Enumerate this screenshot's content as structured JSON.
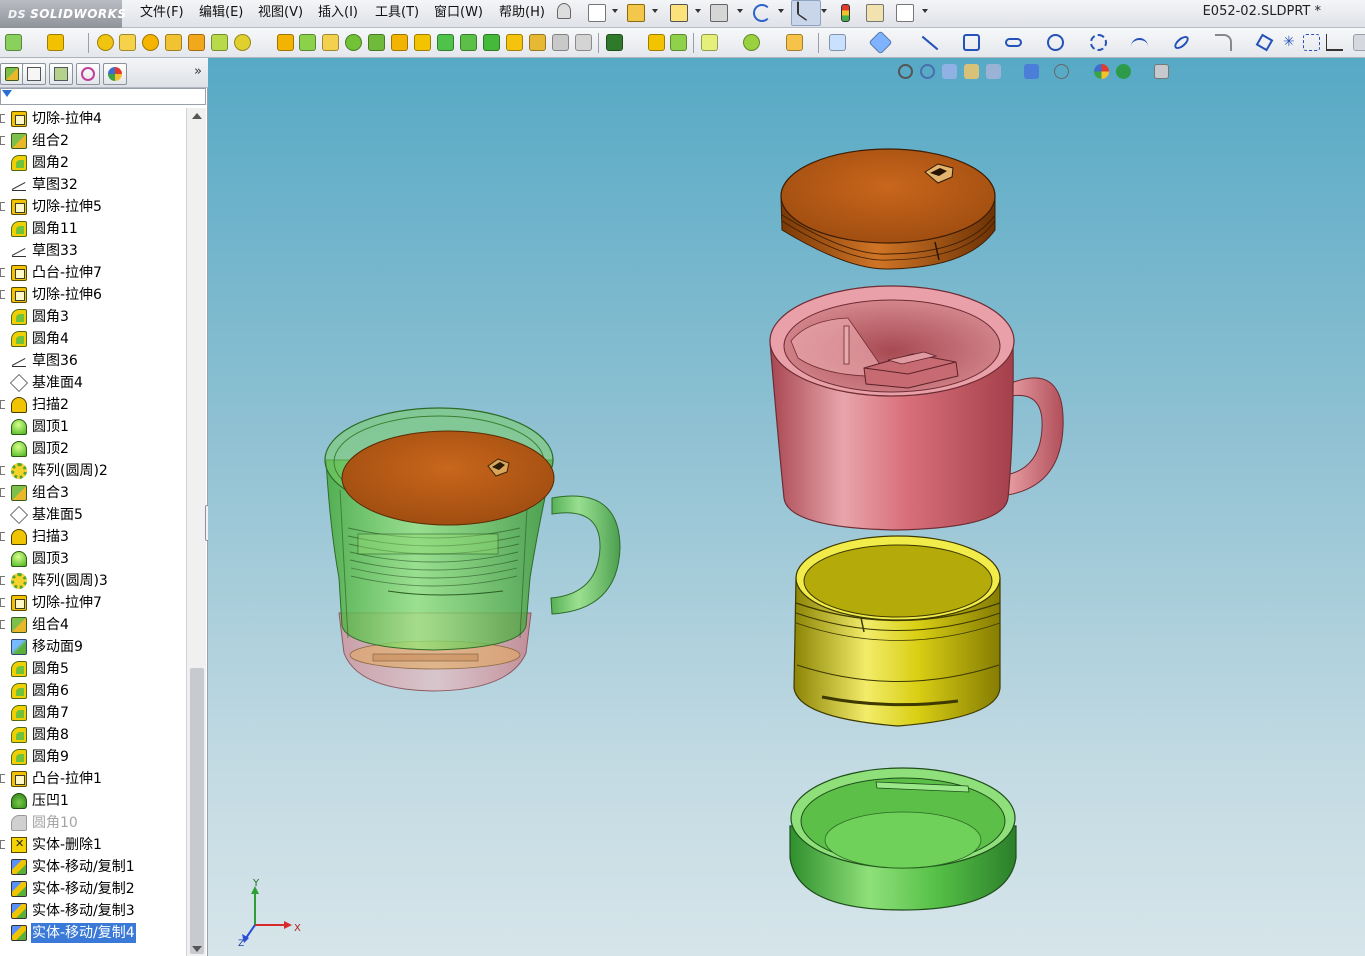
{
  "app": {
    "brand": "SOLIDWORKS",
    "brand_prefix": "DS",
    "document_title": "E052-02.SLDPRT *"
  },
  "menu": {
    "items": [
      "文件(F)",
      "编辑(E)",
      "视图(V)",
      "插入(I)",
      "工具(T)",
      "窗口(W)",
      "帮助(H)"
    ]
  },
  "feature_tree": {
    "items": [
      {
        "label": "切除-拉伸4",
        "icon": "extrude-cut-icon",
        "expandable": true
      },
      {
        "label": "组合2",
        "icon": "combine-icon",
        "expandable": true
      },
      {
        "label": "圆角2",
        "icon": "fillet-icon",
        "expandable": false
      },
      {
        "label": "草图32",
        "icon": "sketch-icon",
        "expandable": false
      },
      {
        "label": "切除-拉伸5",
        "icon": "extrude-cut-icon",
        "expandable": true
      },
      {
        "label": "圆角11",
        "icon": "fillet-icon",
        "expandable": false
      },
      {
        "label": "草图33",
        "icon": "sketch-icon",
        "expandable": false
      },
      {
        "label": "凸台-拉伸7",
        "icon": "boss-extrude-icon",
        "expandable": true
      },
      {
        "label": "切除-拉伸6",
        "icon": "extrude-cut-icon",
        "expandable": true
      },
      {
        "label": "圆角3",
        "icon": "fillet-icon",
        "expandable": false
      },
      {
        "label": "圆角4",
        "icon": "fillet-icon",
        "expandable": false
      },
      {
        "label": "草图36",
        "icon": "sketch-icon",
        "expandable": false
      },
      {
        "label": "基准面4",
        "icon": "plane-icon",
        "expandable": false
      },
      {
        "label": "扫描2",
        "icon": "sweep-icon",
        "expandable": true
      },
      {
        "label": "圆顶1",
        "icon": "dome-icon",
        "expandable": false
      },
      {
        "label": "圆顶2",
        "icon": "dome-icon",
        "expandable": false
      },
      {
        "label": "阵列(圆周)2",
        "icon": "circular-pattern-icon",
        "expandable": true
      },
      {
        "label": "组合3",
        "icon": "combine-icon",
        "expandable": true
      },
      {
        "label": "基准面5",
        "icon": "plane-icon",
        "expandable": false
      },
      {
        "label": "扫描3",
        "icon": "sweep-icon",
        "expandable": true
      },
      {
        "label": "圆顶3",
        "icon": "dome-icon",
        "expandable": false
      },
      {
        "label": "阵列(圆周)3",
        "icon": "circular-pattern-icon",
        "expandable": true
      },
      {
        "label": "切除-拉伸7",
        "icon": "extrude-cut-icon",
        "expandable": true
      },
      {
        "label": "组合4",
        "icon": "combine-icon",
        "expandable": true
      },
      {
        "label": "移动面9",
        "icon": "move-face-icon",
        "expandable": false
      },
      {
        "label": "圆角5",
        "icon": "fillet-icon",
        "expandable": false
      },
      {
        "label": "圆角6",
        "icon": "fillet-icon",
        "expandable": false
      },
      {
        "label": "圆角7",
        "icon": "fillet-icon",
        "expandable": false
      },
      {
        "label": "圆角8",
        "icon": "fillet-icon",
        "expandable": false
      },
      {
        "label": "圆角9",
        "icon": "fillet-icon",
        "expandable": false
      },
      {
        "label": "凸台-拉伸1",
        "icon": "boss-extrude-icon",
        "expandable": true
      },
      {
        "label": "压凹1",
        "icon": "indent-icon",
        "expandable": false
      },
      {
        "label": "圆角10",
        "icon": "fillet-icon",
        "expandable": false,
        "suppressed": true
      },
      {
        "label": "实体-删除1",
        "icon": "body-delete-icon",
        "expandable": true
      },
      {
        "label": "实体-移动/复制1",
        "icon": "body-move-copy-icon",
        "expandable": false
      },
      {
        "label": "实体-移动/复制2",
        "icon": "body-move-copy-icon",
        "expandable": false
      },
      {
        "label": "实体-移动/复制3",
        "icon": "body-move-copy-icon",
        "expandable": false
      },
      {
        "label": "实体-移动/复制4",
        "icon": "body-move-copy-icon",
        "expandable": false,
        "selected": true
      }
    ]
  },
  "triad": {
    "x": "X",
    "y": "Y",
    "z": "Z"
  },
  "colors": {
    "lid_orange": "#c8661a",
    "mug_pink": "#d9707a",
    "cup_yellow": "#d8cc10",
    "base_green": "#5cc44a",
    "assembly_green": "#67c25a",
    "selection_blue": "#3a79d8"
  }
}
